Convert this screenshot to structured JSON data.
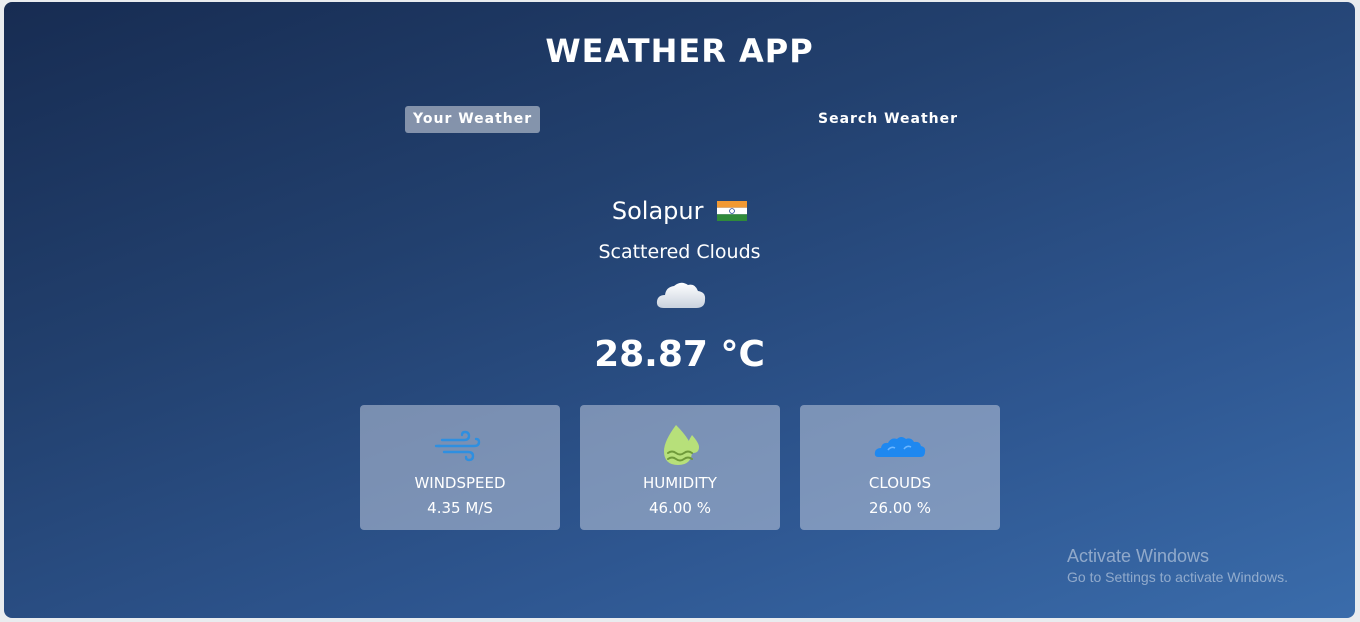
{
  "app": {
    "title": "WEATHER APP"
  },
  "tabs": [
    {
      "label": "Your Weather",
      "active": true
    },
    {
      "label": "Search Weather",
      "active": false
    }
  ],
  "weather": {
    "city": "Solapur",
    "country_flag_icon": "india-flag-icon",
    "description": "Scattered Clouds",
    "condition_icon": "cloud-icon",
    "temperature": "28.87 °C"
  },
  "stats": [
    {
      "icon": "wind-icon",
      "label": "WINDSPEED",
      "value": "4.35 M/S"
    },
    {
      "icon": "humidity-icon",
      "label": "HUMIDITY",
      "value": "46.00 %"
    },
    {
      "icon": "clouds-icon",
      "label": "CLOUDS",
      "value": "26.00 %"
    }
  ],
  "watermark": {
    "title": "Activate Windows",
    "subtitle": "Go to Settings to activate Windows."
  },
  "colors": {
    "background_top": "#172c52",
    "background_bottom": "#3a6cab",
    "wind_icon": "#2f8fe0",
    "humidity_icon": "#b7e07a",
    "clouds_icon": "#1e88f0"
  }
}
